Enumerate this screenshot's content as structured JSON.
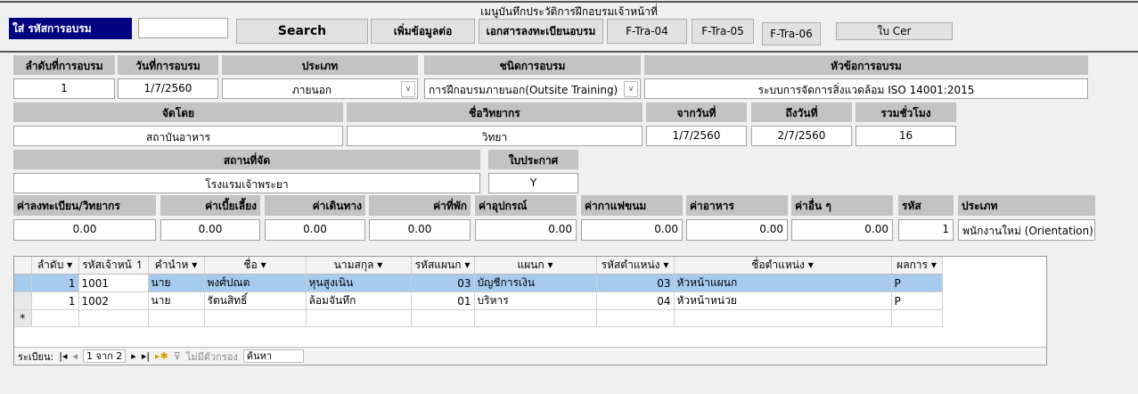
{
  "title": "เมนูบันทึกประวัติการฝึกอบรมเจ้าหน้าที่",
  "search_label": "ใส่ รหัสการอบรม",
  "search_value": "",
  "buttons": {
    "search": "Search",
    "add_more": "เพิ่มข้อมูลต่อ",
    "reg_doc": "เอกสารลงทะเบียนอบรม",
    "ftra04": "F-Tra-04",
    "ftra05": "F-Tra-05",
    "ftra06": "F-Tra-06",
    "cert": "ใบ Cer"
  },
  "fields": {
    "seq": {
      "label": "ลำดับที่การอบรม",
      "value": "1"
    },
    "date": {
      "label": "วันที่การอบรม",
      "value": "1/7/2560"
    },
    "type": {
      "label": "ประเภท",
      "value": "ภายนอก"
    },
    "kind": {
      "label": "ชนิดการอบรม",
      "value": "การฝึกอบรมภายนอก(Outsite Training)"
    },
    "topic": {
      "label": "หัวข้อการอบรม",
      "value": "ระบบการจัดการสิ่งแวดล้อม ISO 14001:2015"
    },
    "organizer": {
      "label": "จัดโดย",
      "value": "สถาบันอาหาร"
    },
    "speaker": {
      "label": "ชื่อวิทยากร",
      "value": "วิทยา"
    },
    "from": {
      "label": "จากวันที่",
      "value": "1/7/2560"
    },
    "to": {
      "label": "ถึงวันที่",
      "value": "2/7/2560"
    },
    "hours": {
      "label": "รวมชั่วโมง",
      "value": "16"
    },
    "venue": {
      "label": "สถานที่จัด",
      "value": "โรงแรมเจ้าพระยา"
    },
    "certificate": {
      "label": "ใบประกาศ",
      "value": "Y"
    },
    "fee_reg": {
      "label": "ค่าลงทะเบียน/วิทยากร",
      "value": "0.00"
    },
    "fee_allow": {
      "label": "ค่าเบี้ยเลี้ยง",
      "value": "0.00"
    },
    "fee_travel": {
      "label": "ค่าเดินทาง",
      "value": "0.00"
    },
    "fee_lodging": {
      "label": "ค่าที่พัก",
      "value": "0.00"
    },
    "fee_equip": {
      "label": "ค่าอุปกรณ์",
      "value": "0.00"
    },
    "fee_coffee": {
      "label": "ค่ากาแฟขนม",
      "value": "0.00"
    },
    "fee_food": {
      "label": "ค่าอาหาร",
      "value": "0.00"
    },
    "fee_other": {
      "label": "ค่าอื่น ๆ",
      "value": "0.00"
    },
    "code": {
      "label": "รหัส",
      "value": "1"
    },
    "category": {
      "label": "ประเภท",
      "value": "พนักงานใหม่ (Orientation)"
    }
  },
  "grid": {
    "columns": [
      "ลำดับ",
      "รหัสเจ้าหน้",
      "คำนำห",
      "ชื่อ",
      "นามสกุล",
      "รหัสแผนก",
      "แผนก",
      "รหัสตำแหน่ง",
      "ชื่อตำแหน่ง",
      "ผลการ"
    ],
    "rows": [
      [
        "1",
        "1001",
        "นาย",
        "พงศ์ปณต",
        "หุนสูงเนิน",
        "03",
        "บัญชีการเงิน",
        "03",
        "หัวหน้าแผนก",
        "P"
      ],
      [
        "1",
        "1002",
        "นาย",
        "รัตนสิทธิ์",
        "ล้อมจันทึก",
        "01",
        "บริหาร",
        "04",
        "หัวหน้าหน่วย",
        "P"
      ]
    ],
    "new_row_marker": "*",
    "nav": {
      "label": "ระเบียน:",
      "position": "1 จาก 2",
      "filter": "ไม่มีตัวกรอง",
      "search": "ค้นหา"
    }
  }
}
